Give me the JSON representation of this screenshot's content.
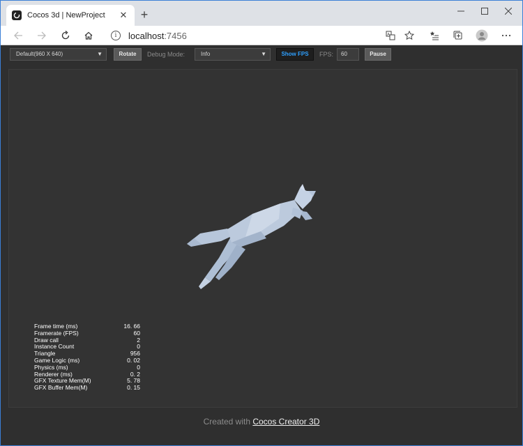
{
  "browser": {
    "tab_title": "Cocos 3d | NewProject",
    "tab_close": "✕",
    "new_tab": "+",
    "url_host": "localhost",
    "url_port": ":7456"
  },
  "toolbar": {
    "resolution": "Default(960 X 640)",
    "rotate_label": "Rotate",
    "debug_mode_label": "Debug Mode:",
    "debug_mode_value": "Info",
    "show_fps_label": "Show FPS",
    "fps_label": "FPS:",
    "fps_value": "60",
    "pause_label": "Pause"
  },
  "stats": [
    {
      "label": "Frame time (ms)",
      "value": "16. 66"
    },
    {
      "label": "Framerate (FPS)",
      "value": "60"
    },
    {
      "label": "Draw call",
      "value": "2"
    },
    {
      "label": "Instance Count",
      "value": "0"
    },
    {
      "label": "Triangle",
      "value": "956"
    },
    {
      "label": "Game Logic (ms)",
      "value": "0. 02"
    },
    {
      "label": "Physics (ms)",
      "value": "0"
    },
    {
      "label": "Renderer (ms)",
      "value": "0. 2"
    },
    {
      "label": "GFX Texture Mem(M)",
      "value": "5. 78"
    },
    {
      "label": "GFX Buffer Mem(M)",
      "value": "0. 15"
    }
  ],
  "footer": {
    "prefix": "Created with ",
    "link": "Cocos Creator 3D"
  },
  "colors": {
    "accent": "#2ea0ff",
    "canvas_bg": "#333333",
    "model": "#b9c8dc"
  }
}
